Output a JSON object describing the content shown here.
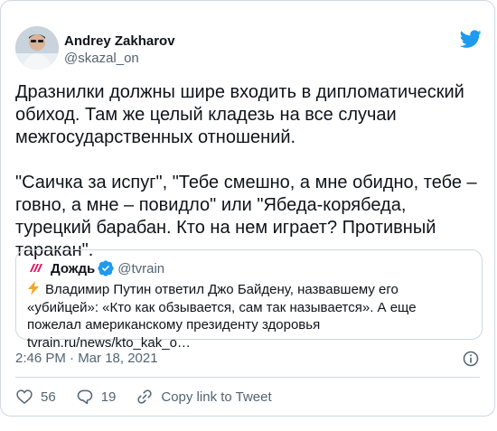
{
  "author": {
    "display_name": "Andrey Zakharov",
    "handle": "@skazal_on"
  },
  "tweet": {
    "text": "Дразнилки должны шире входить в дипломатический обиход. Там же целый кладезь на все случаи межгосударственных отношений.\n\n\"Саичка за испуг\", \"Тебе смешно, а мне обидно, тебе – говно, а мне – повидло\" или \"Ябеда-корябеда, турецкий барабан. Кто на нем играет? Противный таракан\".",
    "timestamp": "2:46 PM · Mar 18, 2021"
  },
  "quoted": {
    "display_name": "Дождь",
    "handle": "@tvrain",
    "text": "Владимир Путин ответил  Джо Байдену, назвавшему его «убийцей»: «Кто как обзывается, сам так называется». А еще пожелал американскому президенту здоровья tvrain.ru/news/kto_kak_o…"
  },
  "actions": {
    "like_count": "56",
    "reply_count": "19",
    "copy_link_label": "Copy link to Tweet"
  },
  "icons": {
    "brand_color": "#1d9bf0",
    "verified_color": "#1d9bf0",
    "tvrain_color": "#e0115f",
    "like": "heart-icon",
    "reply": "reply-icon",
    "copy": "link-icon",
    "info": "info-icon"
  }
}
